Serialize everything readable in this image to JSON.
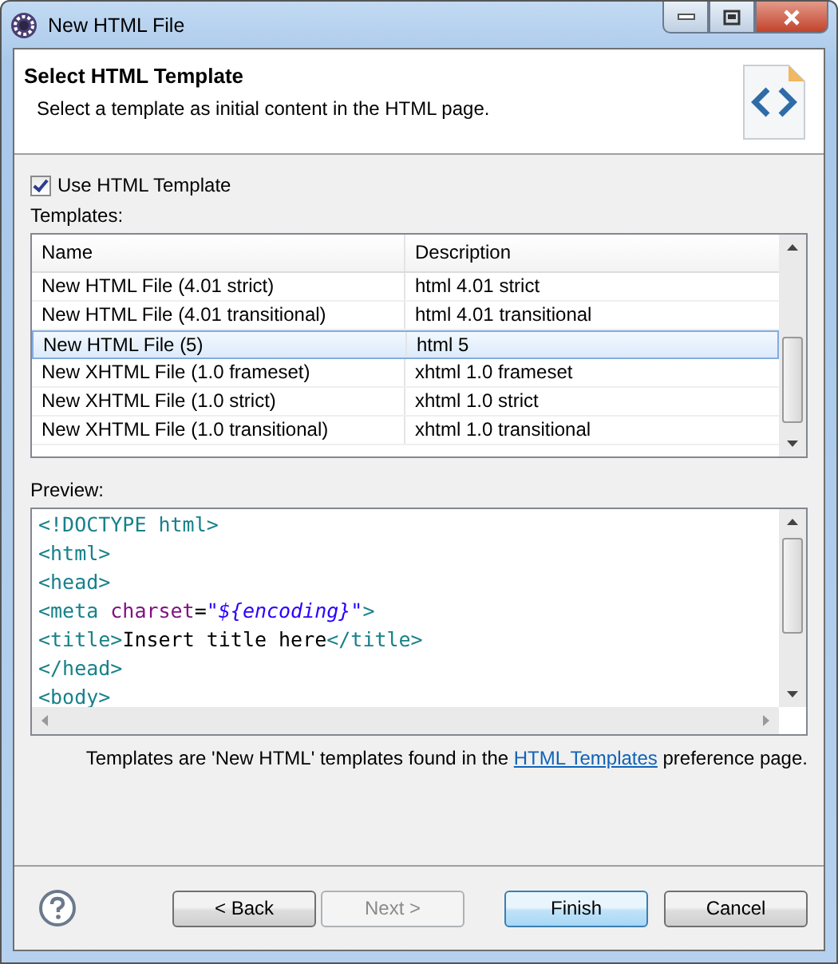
{
  "window": {
    "title": "New HTML File"
  },
  "header": {
    "title": "Select HTML Template",
    "description": "Select a template as initial content in the HTML page."
  },
  "use_template": {
    "label": "Use HTML Template",
    "checked": true
  },
  "templates": {
    "label": "Templates:",
    "columns": [
      "Name",
      "Description"
    ],
    "rows": [
      {
        "name": "New HTML File (4.01 strict)",
        "description": "html 4.01 strict",
        "selected": false
      },
      {
        "name": "New HTML File (4.01 transitional)",
        "description": "html 4.01 transitional",
        "selected": false
      },
      {
        "name": "New HTML File (5)",
        "description": "html 5",
        "selected": true
      },
      {
        "name": "New XHTML File (1.0 frameset)",
        "description": "xhtml 1.0 frameset",
        "selected": false
      },
      {
        "name": "New XHTML File (1.0 strict)",
        "description": "xhtml 1.0 strict",
        "selected": false
      },
      {
        "name": "New XHTML File (1.0 transitional)",
        "description": "xhtml 1.0 transitional",
        "selected": false
      }
    ]
  },
  "preview": {
    "label": "Preview:",
    "lines": [
      [
        {
          "kind": "tag",
          "text": "<!DOCTYPE html>"
        }
      ],
      [
        {
          "kind": "tag",
          "text": "<html>"
        }
      ],
      [
        {
          "kind": "tag",
          "text": "<head>"
        }
      ],
      [
        {
          "kind": "tag",
          "text": "<meta "
        },
        {
          "kind": "attr",
          "text": "charset"
        },
        {
          "kind": "text",
          "text": "="
        },
        {
          "kind": "string",
          "text": "\"${encoding}\""
        },
        {
          "kind": "tag",
          "text": ">"
        }
      ],
      [
        {
          "kind": "tag",
          "text": "<title>"
        },
        {
          "kind": "text",
          "text": "Insert title here"
        },
        {
          "kind": "tag",
          "text": "</title>"
        }
      ],
      [
        {
          "kind": "tag",
          "text": "</head>"
        }
      ],
      [
        {
          "kind": "tag",
          "text": "<body>"
        }
      ]
    ]
  },
  "note": {
    "before": "Templates are 'New HTML' templates found in the ",
    "link": "HTML Templates",
    "after": " preference page."
  },
  "buttons": [
    {
      "label": "< Back",
      "kind": "normal",
      "disabled": false
    },
    {
      "label": "Next >",
      "kind": "normal",
      "disabled": true
    },
    {
      "label": "Finish",
      "kind": "default",
      "disabled": false
    },
    {
      "label": "Cancel",
      "kind": "normal",
      "disabled": false
    }
  ]
}
